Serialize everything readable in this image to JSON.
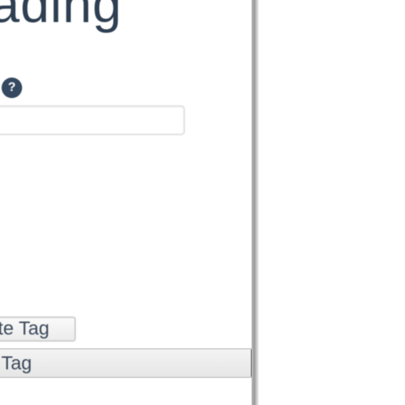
{
  "page": {
    "title": "ading",
    "help_icon": "question-circle-icon",
    "help_icon_glyph": "?"
  },
  "form": {
    "tag_input_value": "",
    "tag_input_placeholder": ""
  },
  "buttons": {
    "tag_button_label": "ate Tag"
  },
  "toolbar": {
    "label": "w Tag"
  },
  "colors": {
    "title_text": "#2e3f52",
    "help_icon_bg": "#354a61",
    "divider": "#9a9a9a",
    "toolbar_bg": "#e9e9e9"
  }
}
